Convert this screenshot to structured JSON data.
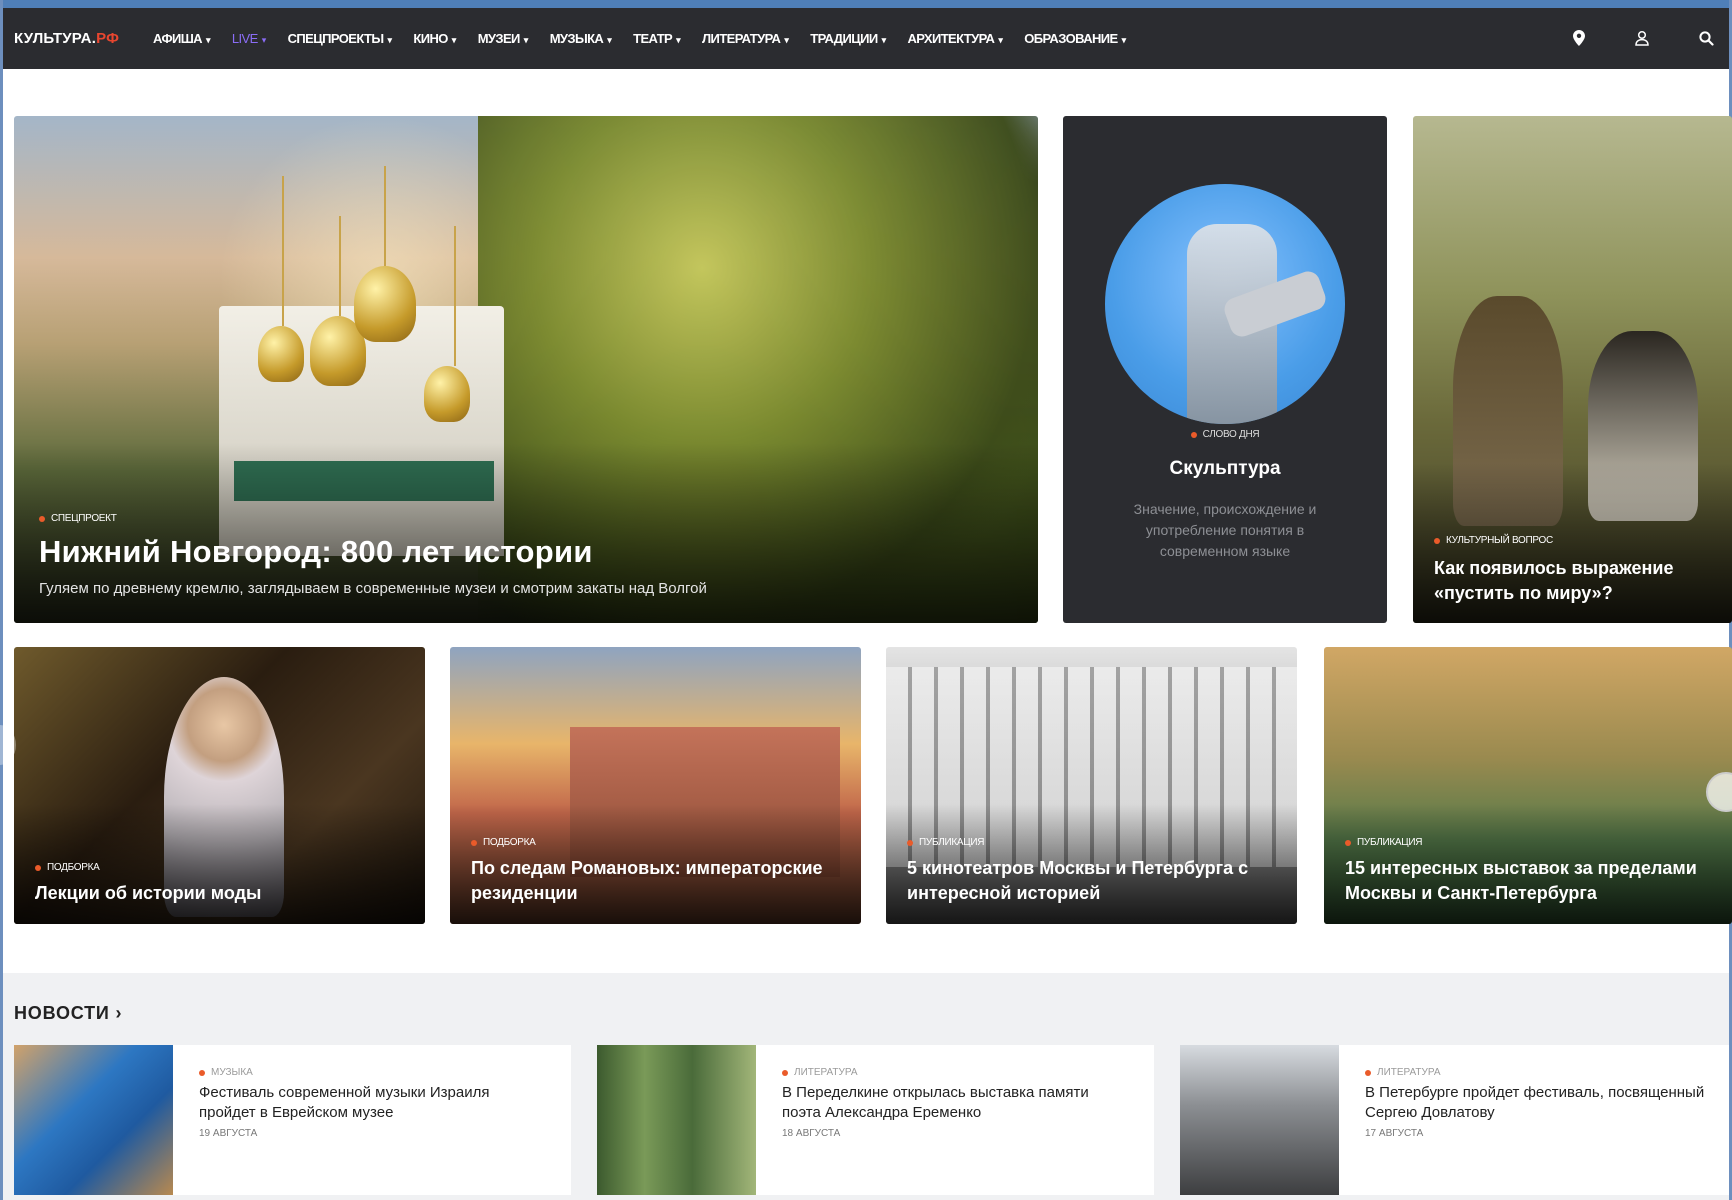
{
  "nav": {
    "logo_main": "КУЛЬТУРА.",
    "logo_suffix": "РФ",
    "items": [
      {
        "label": "АФИША",
        "accent": false
      },
      {
        "label": "LIVE",
        "accent": true
      },
      {
        "label": "СПЕЦПРОЕКТЫ",
        "accent": false
      },
      {
        "label": "КИНО",
        "accent": false
      },
      {
        "label": "МУЗЕИ",
        "accent": false
      },
      {
        "label": "МУЗЫКА",
        "accent": false
      },
      {
        "label": "ТЕАТР",
        "accent": false
      },
      {
        "label": "ЛИТЕРАТУРА",
        "accent": false
      },
      {
        "label": "ТРАДИЦИИ",
        "accent": false
      },
      {
        "label": "АРХИТЕКТУРА",
        "accent": false
      },
      {
        "label": "ОБРАЗОВАНИЕ",
        "accent": false
      }
    ],
    "icons": [
      "location-icon",
      "user-icon",
      "search-icon"
    ],
    "accent_color": "#8b6df7",
    "logo_accent_color": "#e8462f"
  },
  "hero": {
    "tag": "СПЕЦПРОЕКТ",
    "title": "Нижний Новгород: 800 лет истории",
    "subtitle": "Гуляем по древнему кремлю, заглядываем в современные музеи и смотрим закаты над Волгой"
  },
  "word_of_day": {
    "tag": "СЛОВО ДНЯ",
    "title": "Скульптура",
    "description": "Значение, происхождение и употребление понятия в современном языке"
  },
  "question": {
    "tag": "КУЛЬТУРНЫЙ ВОПРОС",
    "title": "Как появилось выражение «пустить по миру»?"
  },
  "cards": [
    {
      "tag": "ПОДБОРКА",
      "title": "Лекции об истории моды"
    },
    {
      "tag": "ПОДБОРКА",
      "title": "По следам Романовых: императорские резиденции"
    },
    {
      "tag": "ПУБЛИКАЦИЯ",
      "title": "5 кинотеатров Москвы и Петербурга с интересной историей"
    },
    {
      "tag": "ПУБЛИКАЦИЯ",
      "title": "15 интересных выставок за пределами Москвы и Санкт-Петербурга"
    }
  ],
  "news": {
    "heading": "НОВОСТИ",
    "heading_arrow": "›",
    "items": [
      {
        "tag": "МУЗЫКА",
        "title": "Фестиваль современной музыки Израиля пройдет в Еврейском музее",
        "date": "19 АВГУСТА"
      },
      {
        "tag": "ЛИТЕРАТУРА",
        "title": "В Переделкине открылась выставка памяти поэта Александра Еременко",
        "date": "18 АВГУСТА"
      },
      {
        "tag": "ЛИТЕРАТУРА",
        "title": "В Петербурге пройдет фестиваль, посвященный Сергею Довлатову",
        "date": "17 АВГУСТА"
      }
    ]
  },
  "colors": {
    "nav_bg": "#2b2c30",
    "tag_dot": "#ea5b2a",
    "news_bg": "#f0f1f3"
  }
}
